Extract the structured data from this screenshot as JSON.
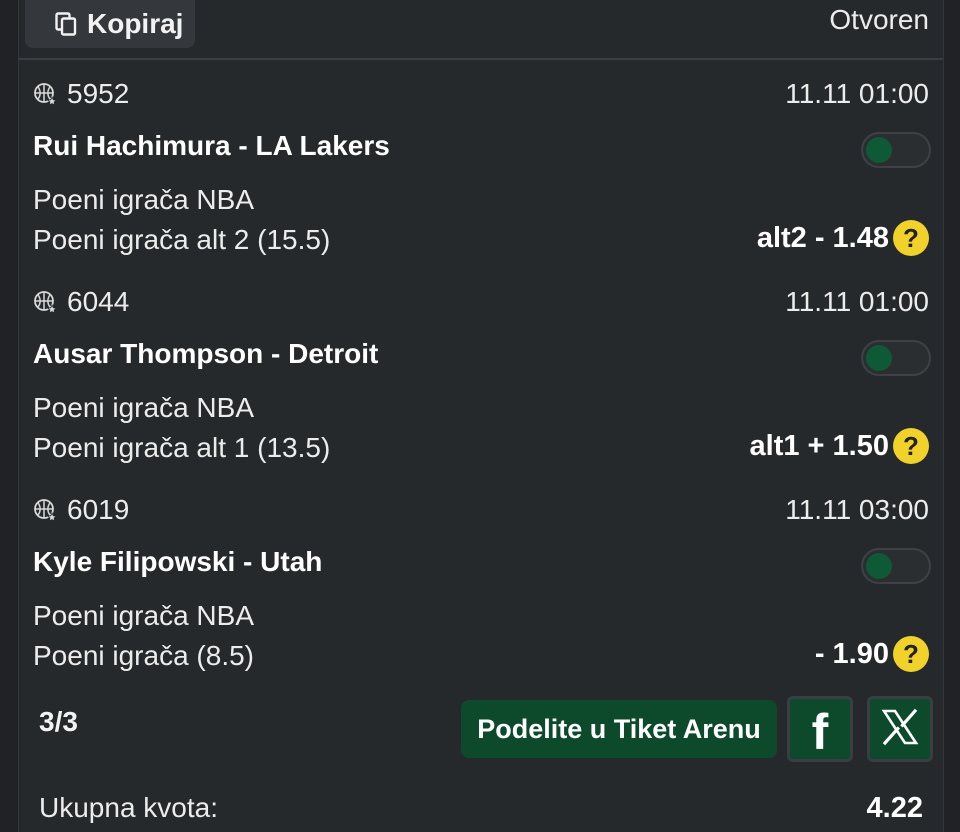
{
  "header": {
    "copy_label": "Kopiraj",
    "status": "Otvoren"
  },
  "matches": [
    {
      "code": "5952",
      "time": "11.11 01:00",
      "player": "Rui Hachimura - LA Lakers",
      "market": "Poeni igrača NBA",
      "bet": "Poeni igrača alt 2 (15.5)",
      "odds": "alt2 - 1.48",
      "toggle_on": false
    },
    {
      "code": "6044",
      "time": "11.11 01:00",
      "player": "Ausar Thompson - Detroit",
      "market": "Poeni igrača NBA",
      "bet": "Poeni igrača alt 1 (13.5)",
      "odds": "alt1 + 1.50",
      "toggle_on": false
    },
    {
      "code": "6019",
      "time": "11.11 03:00",
      "player": "Kyle Filipowski - Utah",
      "market": "Poeni igrača NBA",
      "bet": "Poeni igrača (8.5)",
      "odds": "- 1.90",
      "toggle_on": false
    }
  ],
  "footer": {
    "count": "3/3",
    "share_label": "Podelite u Tiket Arenu",
    "facebook_glyph": "f",
    "total_label": "Ukupna kvota:",
    "total_value": "4.22"
  },
  "help_glyph": "?",
  "colors": {
    "background": "#202225",
    "card": "#26292c",
    "accent_green": "#0d4a2c",
    "help_yellow": "#f0d22b"
  },
  "icons": {
    "copy": "copy-icon",
    "sport": "basketball-icon",
    "help": "question-icon",
    "facebook": "facebook-icon",
    "x": "x-logo-icon"
  }
}
